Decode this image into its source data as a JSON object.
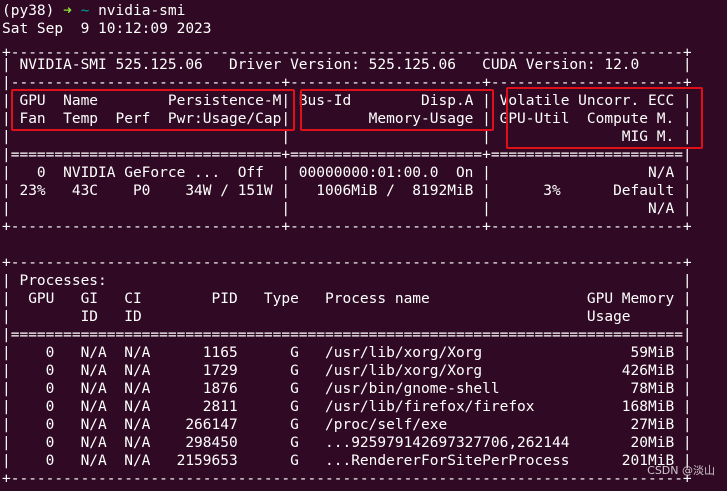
{
  "prompt": {
    "env": "(py38)",
    "arrow": "➜",
    "dir": "~",
    "command": "nvidia-smi"
  },
  "timestamp": "Sat Sep  9 10:12:09 2023",
  "header": {
    "top_border": "+-----------------------------------------------------------------------------+",
    "versions": "| NVIDIA-SMI 525.125.06   Driver Version: 525.125.06   CUDA Version: 12.0     |",
    "mid_border": "|-------------------------------+----------------------+----------------------+",
    "columns_row1": "| GPU  Name        Persistence-M| Bus-Id        Disp.A | Volatile Uncorr. ECC |",
    "columns_row2": "| Fan  Temp  Perf  Pwr:Usage/Cap|         Memory-Usage | GPU-Util  Compute M. |",
    "columns_row3": "|                               |                      |               MIG M. |",
    "double_border": "|===============================+======================+======================|"
  },
  "gpu": {
    "row1": "|   0  NVIDIA GeForce ...  Off  | 00000000:01:00.0  On |                  N/A |",
    "row2": "| 23%   43C    P0    34W / 151W |   1006MiB /  8192MiB |      3%      Default |",
    "row3": "|                               |                      |                  N/A |",
    "bottom_border": "+-------------------------------+----------------------+----------------------+"
  },
  "processes": {
    "top_border": "+-----------------------------------------------------------------------------+",
    "title_row": "| Processes:                                                                  |",
    "header_row1": "|  GPU   GI   CI        PID   Type   Process name                  GPU Memory |",
    "header_row2": "|        ID   ID                                                   Usage      |",
    "double_border": "|=============================================================================|",
    "rows": [
      "|    0   N/A  N/A      1165      G   /usr/lib/xorg/Xorg                 59MiB |",
      "|    0   N/A  N/A      1729      G   /usr/lib/xorg/Xorg                426MiB |",
      "|    0   N/A  N/A      1876      G   /usr/bin/gnome-shell               78MiB |",
      "|    0   N/A  N/A      2811      G   /usr/lib/firefox/firefox          168MiB |",
      "|    0   N/A  N/A    266147      G   /proc/self/exe                     27MiB |",
      "|    0   N/A  N/A    298450      G   ...925979142697327706,262144       20MiB |",
      "|    0   N/A  N/A   2159653      G   ...RendererForSitePerProcess      201MiB |"
    ],
    "bottom_border": "+-----------------------------------------------------------------------------+"
  },
  "watermark": "CSDN @淡山",
  "colors": {
    "background": "#300a24",
    "text": "#ffffff",
    "prompt_arrow": "#8ae234",
    "prompt_dir": "#06989a",
    "highlight_box": "#e0101a"
  }
}
